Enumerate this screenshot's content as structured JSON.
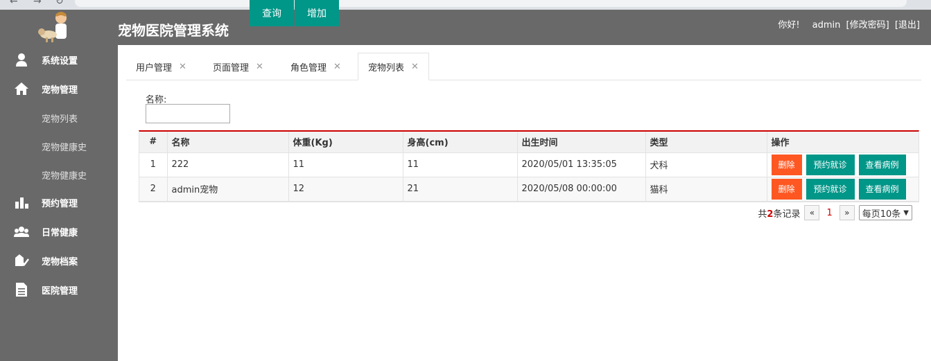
{
  "header": {
    "title": "宠物医院管理系统",
    "greeting": "你好!",
    "username": "admin",
    "change_password": "[修改密码]",
    "logout": "[退出]"
  },
  "sidebar": {
    "items": [
      {
        "label": "系统设置",
        "icon": "user-icon"
      },
      {
        "label": "宠物管理",
        "icon": "home-icon"
      },
      {
        "label": "预约管理",
        "icon": "bar-chart-icon"
      },
      {
        "label": "日常健康",
        "icon": "group-icon"
      },
      {
        "label": "宠物档案",
        "icon": "pet-file-icon"
      },
      {
        "label": "医院管理",
        "icon": "document-icon"
      }
    ],
    "subitems": [
      "宠物列表",
      "宠物健康史",
      "宠物健康史"
    ]
  },
  "tabs": [
    {
      "label": "用户管理"
    },
    {
      "label": "页面管理"
    },
    {
      "label": "角色管理"
    },
    {
      "label": "宠物列表"
    }
  ],
  "search": {
    "label": "名称:",
    "value": "",
    "query_button": "查询",
    "add_button": "增加"
  },
  "table": {
    "columns": [
      "#",
      "名称",
      "体重(Kg)",
      "身高(cm)",
      "出生时间",
      "类型",
      "操作"
    ],
    "rows": [
      {
        "num": "1",
        "name": "222",
        "weight": "11",
        "height": "11",
        "birth": "2020/05/01 13:35:05",
        "type": "犬科"
      },
      {
        "num": "2",
        "name": "admin宠物",
        "weight": "12",
        "height": "21",
        "birth": "2020/05/08 00:00:00",
        "type": "猫科"
      }
    ],
    "actions": {
      "delete": "删除",
      "book": "预约就诊",
      "records": "查看病例"
    }
  },
  "pager": {
    "total_prefix": "共",
    "total_count": "2",
    "total_suffix": "条记录",
    "prev": "«",
    "current_page": "1",
    "next": "»",
    "page_size": "每页10条"
  },
  "colors": {
    "header_bg": "#696969",
    "primary": "#009688",
    "danger": "#ff5722",
    "accent_red": "#cc0000"
  }
}
